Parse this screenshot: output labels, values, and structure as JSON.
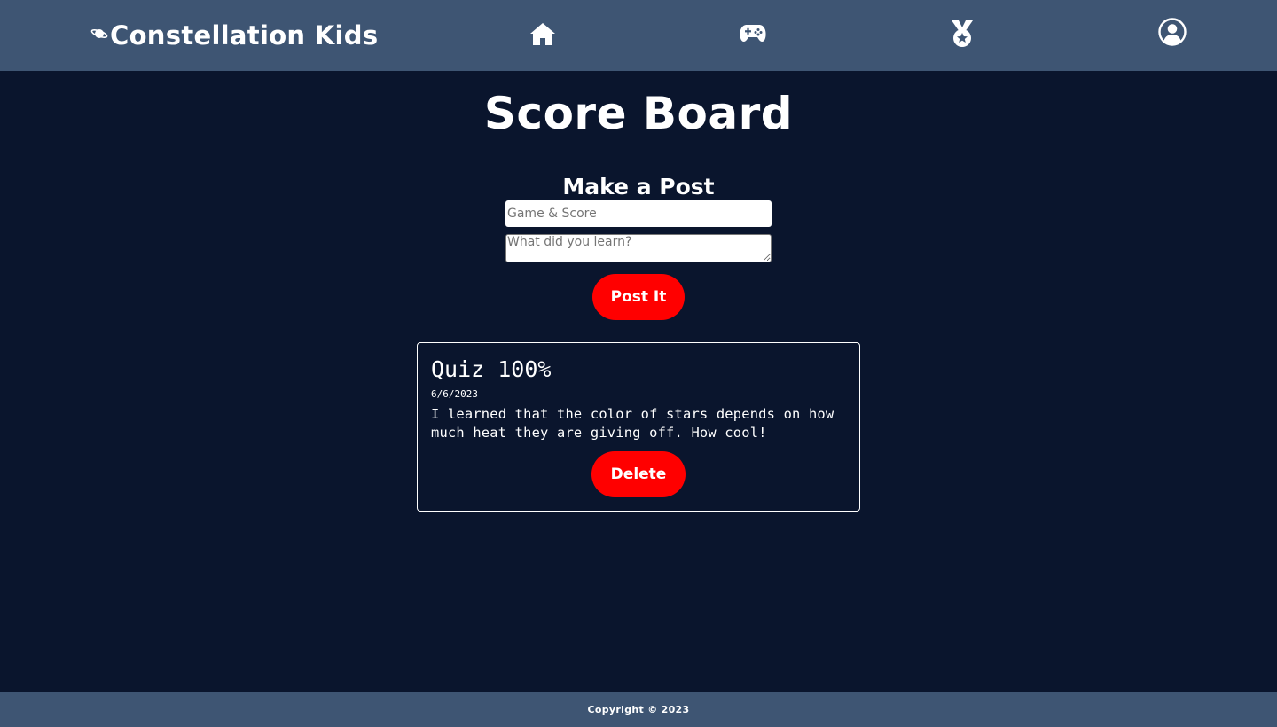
{
  "nav": {
    "brand": "Constellation Kids",
    "brand_icon": "planet-icon",
    "items": [
      {
        "icon": "home-icon"
      },
      {
        "icon": "gamepad-icon"
      },
      {
        "icon": "medal-icon"
      },
      {
        "icon": "user-circle-icon"
      }
    ]
  },
  "main": {
    "title": "Score Board",
    "form": {
      "heading": "Make a Post",
      "game_placeholder": "Game & Score",
      "game_value": "",
      "learn_placeholder": "What did you learn?",
      "learn_value": "",
      "submit_label": "Post It"
    },
    "posts": [
      {
        "title": "Quiz 100%",
        "date": "6/6/2023",
        "body": "I learned that the color of stars depends on how much heat they are giving off. How cool!",
        "delete_label": "Delete"
      }
    ]
  },
  "footer": {
    "text": "Copyright © 2023"
  },
  "colors": {
    "background": "#0a152d",
    "navbar": "#3e5573",
    "accent": "#ff0000",
    "text": "#ffffff"
  }
}
